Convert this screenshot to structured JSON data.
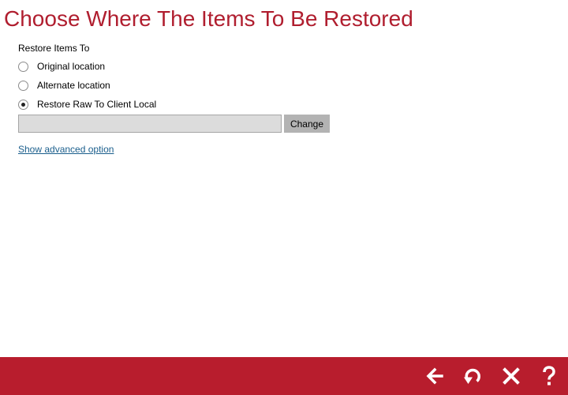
{
  "page": {
    "title": "Choose Where The Items To Be Restored"
  },
  "restore": {
    "section_label": "Restore Items To",
    "options": [
      {
        "label": "Original location",
        "selected": false
      },
      {
        "label": "Alternate location",
        "selected": false
      },
      {
        "label": "Restore Raw To Client Local",
        "selected": true
      }
    ],
    "path_value": "",
    "change_label": "Change",
    "advanced_link": "Show advanced option"
  },
  "footer": {
    "buttons": [
      {
        "icon": "back-arrow-icon",
        "action": "back"
      },
      {
        "icon": "restore-icon",
        "action": "restore"
      },
      {
        "icon": "close-icon",
        "action": "close"
      },
      {
        "icon": "help-icon",
        "action": "help"
      }
    ]
  },
  "colors": {
    "title": "#b01e2f",
    "footer_bar": "#b81d2d",
    "link": "#1a5e8c",
    "input_bg": "#dcdcdc",
    "button_bg": "#b3b3b3"
  }
}
